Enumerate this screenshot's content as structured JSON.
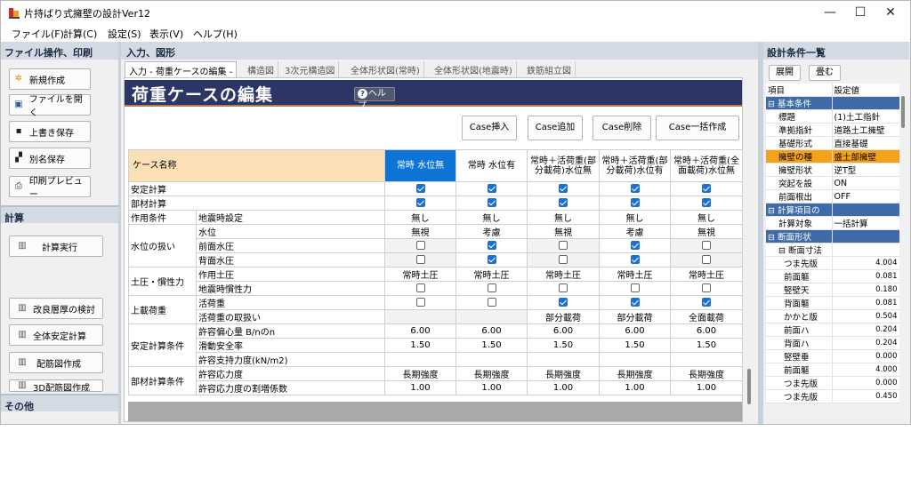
{
  "window": {
    "title": "片持ばり式擁壁の設計Ver12",
    "minimize": "—",
    "maximize": "☐",
    "close": "✕"
  },
  "menu": [
    "ファイル(F)",
    "計算(C)",
    "設定(S)",
    "表示(V)",
    "ヘルプ(H)"
  ],
  "left": {
    "file_header": "ファイル操作、印刷",
    "file_buttons": [
      "新規作成",
      "ファイルを開く",
      "上書き保存",
      "別名保存",
      "印刷プレビュー"
    ],
    "calc_header": "計算",
    "calc_buttons": [
      "計算実行",
      "改良層厚の検討",
      "全体安定計算",
      "配筋図作成",
      "3D配筋図作成"
    ],
    "other_header": "その他"
  },
  "center": {
    "header": "入力、図形",
    "tabs": [
      "入力 - 荷重ケースの編集 -",
      "構造図",
      "3次元構造図",
      "全体形状図(常時)",
      "全体形状図(地震時)",
      "鉄筋組立図"
    ],
    "page_title": "荷重ケースの編集",
    "help_label": "ヘルプ",
    "case_buttons": [
      "Case挿入",
      "Case追加",
      "Case削除",
      "Case一括作成"
    ]
  },
  "grid": {
    "name_header": "ケース名称",
    "cases": [
      "常時 水位無",
      "常時 水位有",
      "常時＋活荷重(部分載荷)水位無",
      "常時＋活荷重(部分載荷)水位有",
      "常時＋活荷重(全面載荷)水位無"
    ],
    "rows": [
      {
        "g": "安定計算",
        "s": "",
        "v": [
          "on",
          "on",
          "on",
          "on",
          "on"
        ]
      },
      {
        "g": "部材計算",
        "s": "",
        "v": [
          "on",
          "on",
          "on",
          "on",
          "on"
        ]
      },
      {
        "g": "作用条件",
        "s": "地震時設定",
        "v": [
          "無し",
          "無し",
          "無し",
          "無し",
          "無し"
        ]
      },
      {
        "g": "水位の扱い",
        "s": "水位",
        "v": [
          "無視",
          "考慮",
          "無視",
          "考慮",
          "無視"
        ]
      },
      {
        "g": "",
        "s": "前面水圧",
        "v": [
          "off",
          "on",
          "off",
          "on",
          "off"
        ]
      },
      {
        "g": "",
        "s": "背面水圧",
        "v": [
          "off",
          "on",
          "off",
          "on",
          "off"
        ]
      },
      {
        "g": "土圧・慣性力",
        "s": "作用土圧",
        "v": [
          "常時土圧",
          "常時土圧",
          "常時土圧",
          "常時土圧",
          "常時土圧"
        ]
      },
      {
        "g": "",
        "s": "地震時慣性力",
        "v": [
          "off",
          "off",
          "off",
          "off",
          "off"
        ]
      },
      {
        "g": "上載荷重",
        "s": "活荷重",
        "v": [
          "off",
          "off",
          "on",
          "on",
          "on"
        ]
      },
      {
        "g": "",
        "s": "活荷重の取扱い",
        "v": [
          "",
          "",
          "部分載荷",
          "部分載荷",
          "全面載荷"
        ]
      },
      {
        "g": "安定計算条件",
        "s": "許容偏心量 B/nのn",
        "v": [
          "6.00",
          "6.00",
          "6.00",
          "6.00",
          "6.00"
        ]
      },
      {
        "g": "",
        "s": "滑動安全率",
        "v": [
          "1.50",
          "1.50",
          "1.50",
          "1.50",
          "1.50"
        ]
      },
      {
        "g": "",
        "s": "許容支持力度(kN/m2)",
        "v": [
          "",
          "",
          "",
          "",
          ""
        ]
      },
      {
        "g": "部材計算条件",
        "s": "許容応力度",
        "v": [
          "長期強度",
          "長期強度",
          "長期強度",
          "長期強度",
          "長期強度"
        ]
      },
      {
        "g": "",
        "s": "許容応力度の割増係数",
        "v": [
          "1.00",
          "1.00",
          "1.00",
          "1.00",
          "1.00"
        ]
      }
    ]
  },
  "right": {
    "header": "設計条件一覧",
    "expand": "展開",
    "collapse": "畳む",
    "col_item": "項目",
    "col_value": "設定値",
    "props": [
      {
        "t": "grp",
        "k": "⊟ 基本条件",
        "v": ""
      },
      {
        "t": "",
        "k": "標題",
        "v": "(1)土工指針"
      },
      {
        "t": "",
        "k": "準拠指針",
        "v": "道路土工擁壁"
      },
      {
        "t": "",
        "k": "基礎形式",
        "v": "直接基礎"
      },
      {
        "t": "hi",
        "k": "擁壁の種",
        "v": "盛土部擁壁"
      },
      {
        "t": "",
        "k": "擁壁形状",
        "v": "逆T型"
      },
      {
        "t": "",
        "k": "突起を設",
        "v": "ON"
      },
      {
        "t": "",
        "k": "前面根出",
        "v": "OFF"
      },
      {
        "t": "grp",
        "k": "⊟ 計算項目の",
        "v": ""
      },
      {
        "t": "",
        "k": "計算対象",
        "v": "一括計算"
      },
      {
        "t": "grp",
        "k": "⊟ 断面形状",
        "v": ""
      },
      {
        "t": "",
        "k": "⊟ 断面寸法",
        "v": ""
      },
      {
        "t": "n",
        "k": "つま先版",
        "v": "4.004"
      },
      {
        "t": "n",
        "k": "前面軀",
        "v": "0.081"
      },
      {
        "t": "n",
        "k": "竪壁天",
        "v": "0.180"
      },
      {
        "t": "n",
        "k": "背面軀",
        "v": "0.081"
      },
      {
        "t": "n",
        "k": "かかと版",
        "v": "0.504"
      },
      {
        "t": "n",
        "k": "前面ハ",
        "v": "0.204"
      },
      {
        "t": "n",
        "k": "背面ハ",
        "v": "0.204"
      },
      {
        "t": "n",
        "k": "竪壁垂",
        "v": "0.000"
      },
      {
        "t": "n",
        "k": "前面軀",
        "v": "4.000"
      },
      {
        "t": "n",
        "k": "つま先版",
        "v": "0.000"
      },
      {
        "t": "n",
        "k": "つま先版",
        "v": "0.450"
      }
    ]
  }
}
